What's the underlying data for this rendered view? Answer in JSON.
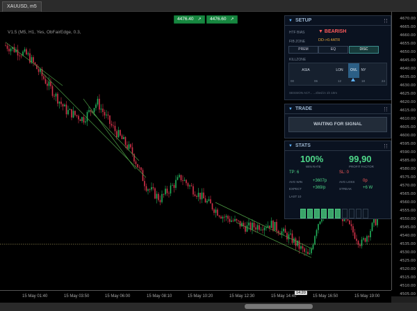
{
  "tab": {
    "title": "XAUUSD, m5"
  },
  "chart": {
    "info": "V1.5 (M5, H1, Yes, ObFairEdge, 0.3,",
    "level_price": "4535.00",
    "buy_buttons": [
      {
        "label": "4476.40",
        "icon": "arrow-up-right-icon"
      },
      {
        "label": "4476.60",
        "icon": "arrow-up-right-icon"
      }
    ],
    "price_ticks": [
      "4670.00",
      "4665.00",
      "4660.00",
      "4655.00",
      "4650.00",
      "4645.00",
      "4640.00",
      "4635.00",
      "4630.00",
      "4625.00",
      "4620.00",
      "4615.00",
      "4610.00",
      "4605.00",
      "4600.00",
      "4595.00",
      "4590.00",
      "4585.00",
      "4580.00",
      "4575.00",
      "4570.00",
      "4565.00",
      "4560.00",
      "4555.00",
      "4550.00",
      "4545.00",
      "4540.00",
      "4535.00",
      "4530.00",
      "4525.00",
      "4520.00",
      "4515.00",
      "4510.00",
      "4505.00"
    ],
    "time_labels": [
      "15 May 01:40",
      "15 May 03:50",
      "15 May 06:00",
      "15 May 08:10",
      "15 May 10:20",
      "15 May 12:30",
      "15 May 14:40",
      "15 May 16:50",
      "15 May 19:00"
    ],
    "time_marker": "14:20",
    "colors": {
      "bull": "#22b35c",
      "bear": "#d6334b",
      "trend": "#4fa046",
      "level": "#d8c77a"
    }
  },
  "panel": {
    "setup": {
      "title": "SETUP",
      "htf_bias_label": "HTF BIAS",
      "htf_bias_value": "BEARISH",
      "bias_color": "#ff5b5b",
      "fib_zone_label": "FIB ZONE",
      "fib_zone_value": "DD->0.4ATR",
      "fib_buttons": [
        {
          "label": "PREM",
          "active": false
        },
        {
          "label": "EQ",
          "active": false
        },
        {
          "label": "DISC",
          "active": true
        }
      ],
      "killzone_label": "KILLZONE",
      "killzones": [
        {
          "label": "ASIA",
          "active": false
        },
        {
          "label": "LON",
          "active": false
        },
        {
          "label": "OVL",
          "active": true
        },
        {
          "label": "NY",
          "active": false
        }
      ],
      "hours": [
        "00",
        "06",
        "12",
        "18",
        "24"
      ],
      "session_note": "SESSION ACT...  ...shed in 1h 10m"
    },
    "trade": {
      "title": "TRADE",
      "status": "WAITING FOR SIGNAL"
    },
    "stats": {
      "title": "STATS",
      "win_rate": "100%",
      "win_rate_label": "WIN RATE",
      "profit_factor": "99,90",
      "profit_factor_label": "PROFIT FACTOR",
      "tp_text": "TP: 6",
      "sl_text": "SL: 0",
      "avg_win_label": "AVG WIN",
      "avg_win_value": "+3607p",
      "avg_loss_label": "AVG LOSS",
      "avg_loss_value": "0p",
      "expect_label": "EXPECT",
      "expect_value": "+369/p",
      "streak_label": "STREAK",
      "streak_value": "+6 W",
      "last_label": "LAST 10",
      "last10": [
        "W",
        "W",
        "W",
        "W",
        "W",
        "W",
        "",
        "",
        "",
        ""
      ]
    }
  }
}
